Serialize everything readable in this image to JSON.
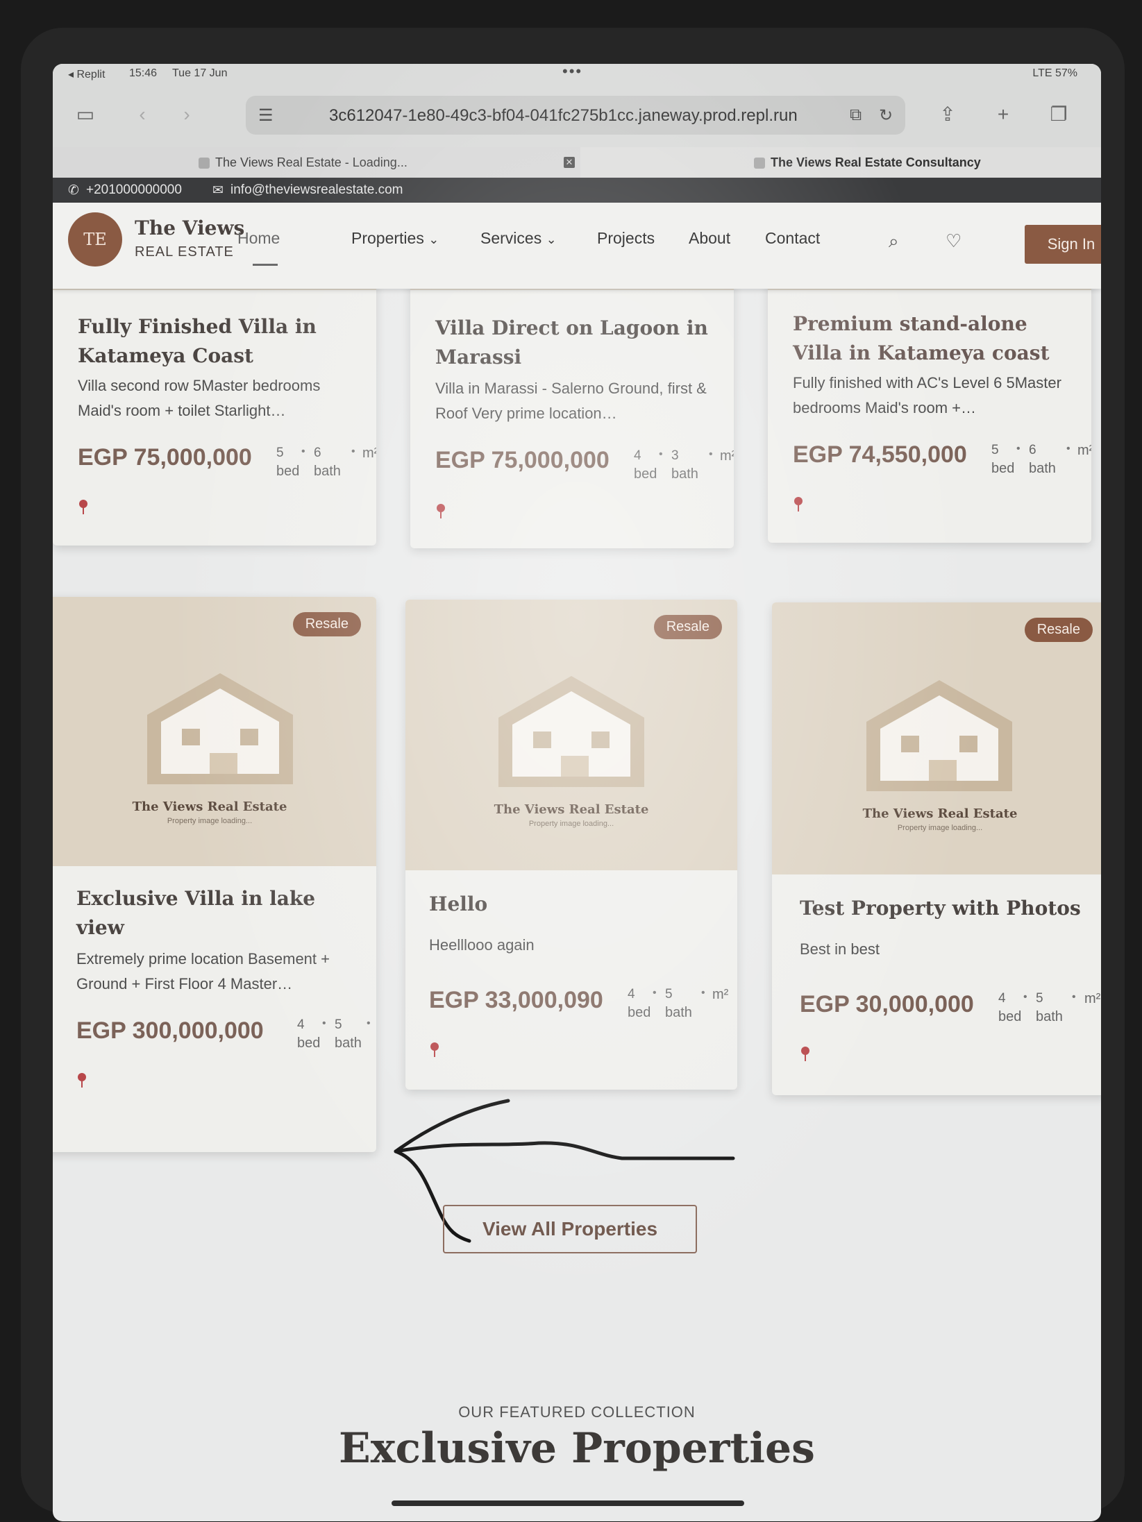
{
  "status_bar": {
    "back_app": "◂ Replit",
    "time": "15:46",
    "date": "Tue 17 Jun",
    "dots": "•••",
    "signal": "LTE 57%"
  },
  "browser": {
    "url": "3c612047-1e80-49c3-bf04-041fc275b1cc.janeway.prod.repl.run",
    "tabs": [
      {
        "title": "The Views Real Estate - Loading..."
      },
      {
        "title": "The Views Real Estate Consultancy"
      }
    ]
  },
  "contact": {
    "phone": "+201000000000",
    "email": "info@theviewsrealestate.com"
  },
  "header": {
    "logo_initials": "TE",
    "brand_name": "The Views",
    "brand_sub": "REAL ESTATE",
    "nav": {
      "home": "Home",
      "properties": "Properties",
      "services": "Services",
      "projects": "Projects",
      "about": "About",
      "contact": "Contact"
    },
    "chevron": "⌄",
    "sign_in": "Sign In"
  },
  "cards": [
    {
      "title": "Fully Finished Villa in Katameya Coast",
      "desc": "Villa second row 5Master bedrooms Maid's room + toilet Starlight…",
      "price": "EGP 75,000,000",
      "beds": "5",
      "baths": "6",
      "bed_label": "bed",
      "bath_label": "bath",
      "area_unit": "m²"
    },
    {
      "title": "Villa Direct on Lagoon in Marassi",
      "desc": "Villa in Marassi - Salerno Ground, first & Roof Very prime location…",
      "price": "EGP 75,000,000",
      "beds": "4",
      "baths": "3",
      "bed_label": "bed",
      "bath_label": "bath",
      "area_unit": "m²"
    },
    {
      "title": "Premium stand-alone Villa in Katameya coast",
      "desc": "Fully finished with AC's Level 6 5Master bedrooms Maid's room +…",
      "price": "EGP 74,550,000",
      "beds": "5",
      "baths": "6",
      "bed_label": "bed",
      "bath_label": "bath",
      "area_unit": "m²"
    },
    {
      "badge": "Resale",
      "ph_title": "The Views Real Estate",
      "ph_sub": "Property image loading...",
      "title": "Exclusive Villa in lake view",
      "desc": "Extremely prime location Basement + Ground + First Floor 4 Master…",
      "price": "EGP 300,000,000",
      "beds": "4",
      "baths": "5",
      "bed_label": "bed",
      "bath_label": "bath"
    },
    {
      "badge": "Resale",
      "ph_title": "The Views Real Estate",
      "ph_sub": "Property image loading...",
      "title": "Hello",
      "desc": "Heelllooo again",
      "price": "EGP 33,000,090",
      "beds": "4",
      "baths": "5",
      "bed_label": "bed",
      "bath_label": "bath",
      "area_unit": "m²"
    },
    {
      "badge": "Resale",
      "ph_title": "The Views Real Estate",
      "ph_sub": "Property image loading...",
      "title": "Test Property with Photos",
      "desc": "Best in best",
      "price": "EGP 30,000,000",
      "beds": "4",
      "baths": "5",
      "bed_label": "bed",
      "bath_label": "bath",
      "area_unit": "m²"
    }
  ],
  "view_all": "View All Properties",
  "featured": {
    "sub": "OUR FEATURED COLLECTION",
    "title": "Exclusive Properties"
  },
  "colors": {
    "accent": "#8a5a43",
    "price": "#7b6258",
    "pin": "#b8474a"
  }
}
